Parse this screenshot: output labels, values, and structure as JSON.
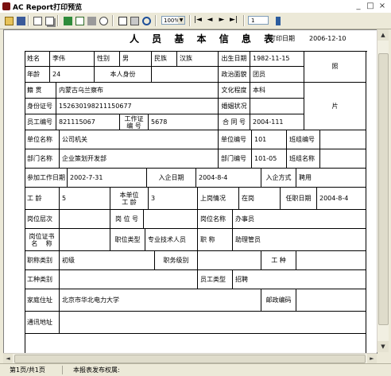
{
  "window": {
    "title": "AC Report打印预览",
    "minimize": "_",
    "maximize": "□",
    "close": "×"
  },
  "toolbar": {
    "zoom": "100%",
    "page_input": "1",
    "nav_first": "|◄",
    "nav_prev": "◄",
    "nav_next": "►",
    "nav_last": "►|"
  },
  "report": {
    "title": "人 员 基 本 信 息 表",
    "print_date_label": "打印日期",
    "print_date": "2006-12-10",
    "photo_label_top": "照",
    "photo_label_bottom": "片",
    "labels": {
      "name": "姓名",
      "gender": "性别",
      "ethnicity": "民族",
      "birth_date": "出生日期",
      "age": "年龄",
      "identity": "本人身份",
      "political": "政治面貌",
      "native_place": "籍    贯",
      "education": "文化程度",
      "id_number": "身份证号",
      "marital": "婚姻状况",
      "employee_no": "员工编号",
      "work_permit_no": "工作证\n编 号",
      "contract_no": "合 同 号",
      "org_name": "单位名称",
      "org_code": "单位编号",
      "team_code": "班组编号",
      "dept_name": "部门名称",
      "dept_code": "部门编号",
      "team_name": "班组名称",
      "work_start": "参加工作日期",
      "join_date": "入企日期",
      "join_method": "入企方式",
      "seniority": "工    龄",
      "org_seniority": "本单位\n工 龄",
      "status": "上岗情况",
      "appoint_date": "任职日期",
      "position_level": "岗位层次",
      "position_no": "岗 位 号",
      "position_name": "岗位名称",
      "cert_name": "岗位证书\n名    称",
      "position_type": "职位类型",
      "title": "职    称",
      "title_category": "职称类别",
      "duty_level": "职务级别",
      "work_type": "工    种",
      "work_category": "工种类别",
      "employee_type": "员工类型",
      "home_address": "家庭住址",
      "postal_code": "邮政编码",
      "mail_address": "通讯地址"
    },
    "values": {
      "name": "李伟",
      "gender": "男",
      "ethnicity": "汉族",
      "birth_date": "1982-11-15",
      "age": "24",
      "identity": "",
      "political": "团员",
      "native_place": "内蒙古乌兰察布",
      "education": "本科",
      "id_number": "152630198211150677",
      "marital": "",
      "employee_no": "821115067",
      "work_permit_no": "5678",
      "contract_no": "2004-111",
      "org_name": "公司机关",
      "org_code": "101",
      "team_code": "",
      "dept_name": "企业策划开发部",
      "dept_code": "101-05",
      "team_name": "",
      "work_start": "2002-7-31",
      "join_date": "2004-8-4",
      "join_method": "聘用",
      "seniority": "5",
      "org_seniority": "3",
      "status": "在岗",
      "appoint_date": "2004-8-4",
      "position_level": "",
      "position_no": "",
      "position_name": "办事员",
      "cert_name": "",
      "position_type": "专业技术人员",
      "title": "助理管员",
      "title_category": "初级",
      "duty_level": "",
      "work_type": "",
      "work_category": "",
      "employee_type": "招聘",
      "home_address": "北京市华北电力大学",
      "postal_code": "",
      "mail_address": ""
    }
  },
  "status": {
    "page": "第1页/共1页",
    "publisher_label": "本报表发布权属:"
  }
}
